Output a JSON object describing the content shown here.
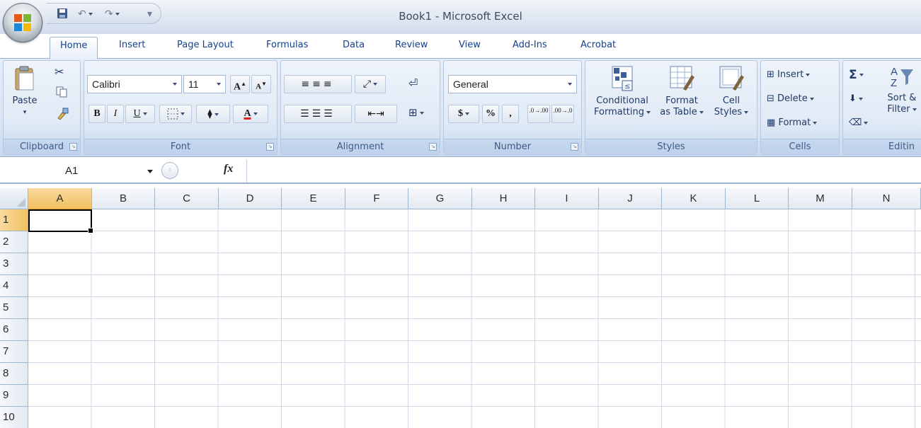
{
  "window": {
    "title": "Book1 - Microsoft Excel"
  },
  "quick_access": {
    "save_icon": "save-icon",
    "undo_icon": "undo-icon",
    "redo_icon": "redo-icon",
    "customize_icon": "qat-customize-icon"
  },
  "tabs": [
    {
      "label": "Home",
      "active": true
    },
    {
      "label": "Insert"
    },
    {
      "label": "Page Layout"
    },
    {
      "label": "Formulas"
    },
    {
      "label": "Data"
    },
    {
      "label": "Review"
    },
    {
      "label": "View"
    },
    {
      "label": "Add-Ins"
    },
    {
      "label": "Acrobat"
    }
  ],
  "ribbon": {
    "clipboard": {
      "label": "Clipboard",
      "paste": "Paste"
    },
    "font": {
      "label": "Font",
      "family": "Calibri",
      "size": "11",
      "bold": "B",
      "italic": "I",
      "underline": "U",
      "grow": "A",
      "shrink": "A"
    },
    "alignment": {
      "label": "Alignment"
    },
    "number": {
      "label": "Number",
      "format": "General",
      "currency": "$",
      "percent": "%",
      "comma": ",",
      "inc_decimal": ".0→.00",
      "dec_decimal": ".00→.0"
    },
    "styles": {
      "label": "Styles",
      "conditional": [
        "Conditional",
        "Formatting"
      ],
      "format_table": [
        "Format",
        "as Table"
      ],
      "cell_styles": [
        "Cell",
        "Styles"
      ]
    },
    "cells": {
      "label": "Cells",
      "insert": "Insert",
      "delete": "Delete",
      "format": "Format"
    },
    "editing": {
      "label": "Editin",
      "sigma": "Σ",
      "sort": [
        "Sort &",
        "Filter"
      ]
    }
  },
  "formula_bar": {
    "name_box": "A1",
    "fx": "fx",
    "value": ""
  },
  "grid": {
    "columns": [
      "A",
      "B",
      "C",
      "D",
      "E",
      "F",
      "G",
      "H",
      "I",
      "J",
      "K",
      "L",
      "M",
      "N"
    ],
    "rows": [
      "1",
      "2",
      "3",
      "4",
      "5",
      "6",
      "7",
      "8",
      "9",
      "10"
    ],
    "selected_cell": "A1"
  },
  "colors": {
    "ribbon": "#dae5f3",
    "accent": "#15428b",
    "selected_header": "#f1c15f",
    "gridline": "#d0d7e5"
  }
}
